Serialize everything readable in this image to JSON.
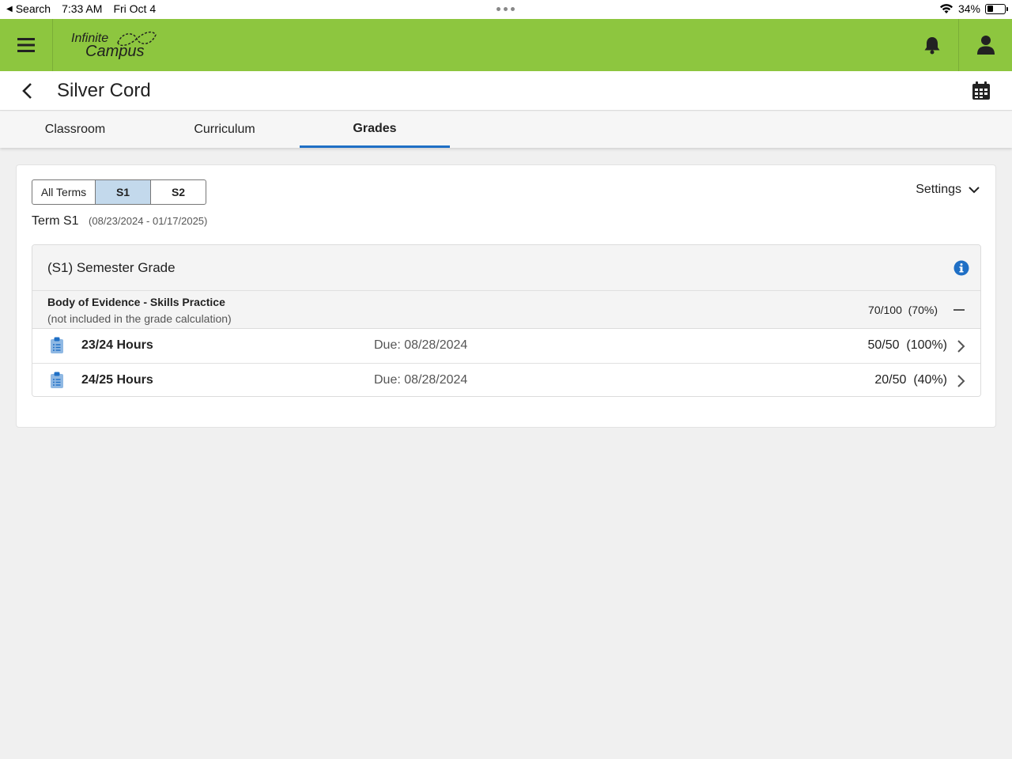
{
  "status_bar": {
    "back_label": "Search",
    "time": "7:33 AM",
    "date": "Fri Oct 4",
    "battery": "34%",
    "battery_level": 0.34
  },
  "app_bar": {
    "logo_line1": "Infinite",
    "logo_line2": "Campus",
    "icons": [
      "hamburger-menu-icon",
      "bell-icon",
      "user-icon"
    ],
    "brand_color": "#8dc63f"
  },
  "header": {
    "title": "Silver Cord",
    "icons": [
      "chevron-left-icon",
      "calendar-icon"
    ]
  },
  "tabs": [
    {
      "label": "Classroom",
      "active": false
    },
    {
      "label": "Curriculum",
      "active": false
    },
    {
      "label": "Grades",
      "active": true
    }
  ],
  "terms": {
    "options": [
      "All Terms",
      "S1",
      "S2"
    ],
    "selected": "S1"
  },
  "settings_label": "Settings",
  "term": {
    "label": "Term S1",
    "dates": "(08/23/2024 - 01/17/2025)"
  },
  "grade": {
    "title": "(S1) Semester Grade",
    "category": {
      "name": "Body of Evidence - Skills Practice",
      "note": "(not included in the grade calculation)",
      "score": "70/100",
      "percent": "(70%)"
    },
    "assignments": [
      {
        "name": "23/24 Hours",
        "due": "Due: 08/28/2024",
        "score": "50/50",
        "percent": "(100%)"
      },
      {
        "name": "24/25 Hours",
        "due": "Due: 08/28/2024",
        "score": "20/50",
        "percent": "(40%)"
      }
    ]
  },
  "accent_color": "#1f6fc5"
}
